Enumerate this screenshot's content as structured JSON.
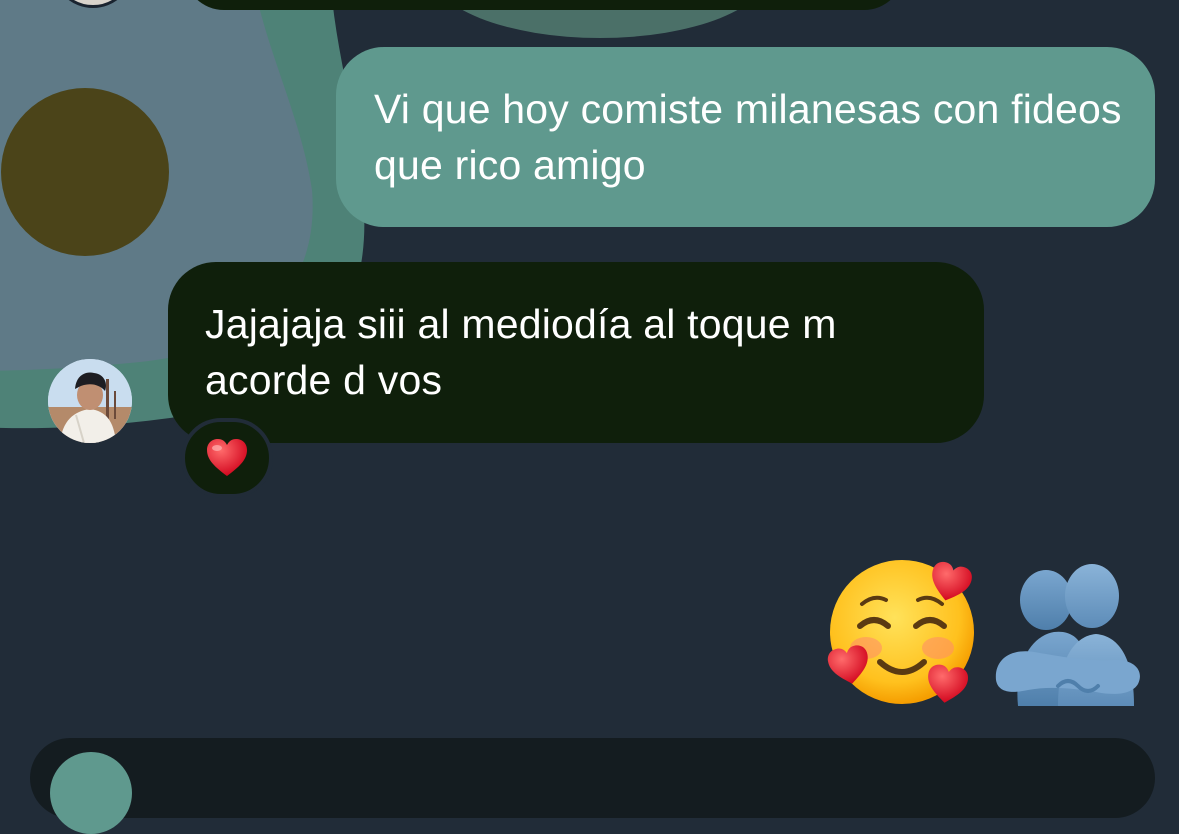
{
  "conversation": {
    "messages": [
      {
        "direction": "outgoing",
        "text": "Vi que hoy comiste milanesas con fideos que rico amigo"
      },
      {
        "direction": "incoming",
        "text": "Jajajaja siii al mediodía al toque m acorde d vos",
        "reaction": "red-heart"
      },
      {
        "direction": "outgoing",
        "emojis": [
          "smiling-face-with-hearts",
          "people-hugging"
        ]
      }
    ]
  },
  "colors": {
    "background": "#212c38",
    "outgoing_bubble": "#5f998e",
    "incoming_bubble": "#0f1f0b",
    "wallpaper_avocado": "#5f7a87",
    "avocado_pit": "#4b4419",
    "text": "#ffffff"
  },
  "icons": {
    "reaction": "red-heart-icon",
    "avatar": "contact-avatar"
  }
}
